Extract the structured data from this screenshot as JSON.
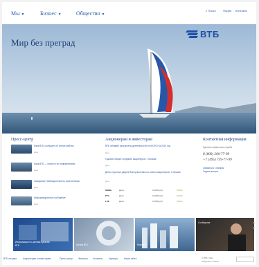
{
  "nav": {
    "menu": [
      {
        "label": "Мы"
      },
      {
        "label": "Бизнес"
      },
      {
        "label": "Общество"
      }
    ],
    "util": [
      "Поиск",
      "Форум",
      "Контакты"
    ]
  },
  "hero": {
    "title": "Мир без преград",
    "logo": "ВТБ"
  },
  "press": {
    "title": "Пресс-центр",
    "items": [
      {
        "text": "Банк ВТБ сообщает об итогах работы",
        "date": "Дата"
      },
      {
        "text": "Банк ВТБ — новости по направлениям",
        "date": "Дата"
      },
      {
        "text": "Заседание Наблюдательного совета банка",
        "date": "Дата"
      },
      {
        "text": "Информационное сообщение",
        "date": "Дата"
      }
    ]
  },
  "investors": {
    "title": "Акционерам и инвесторам",
    "items": [
      {
        "text": "ВТБ объявил результаты деятельности по МСФО за 2010 год",
        "date": "Дата"
      },
      {
        "text": "Годовое общее собрание акционеров, г. Москва",
        "date": "Дата"
      },
      {
        "text": "День открытых дверей Консультативного совета акционеров, г. Москва",
        "date": "Дата"
      }
    ],
    "quotes": [
      {
        "ticker": "ММВБ",
        "date": "Дата",
        "price": "0,0000 руб",
        "change": "0,00%"
      },
      {
        "ticker": "РТС",
        "date": "Дата",
        "price": "0,0000 руб",
        "change": "0,00%"
      },
      {
        "ticker": "LSE",
        "date": "Дата",
        "price": "0,0000 руб",
        "change": "0,00%"
      }
    ]
  },
  "contact": {
    "title": "Контактная информация",
    "subtitle": "Единая справочная служба",
    "phone1": "8 (800) 200-77-99",
    "phone2": "+7 (495) 739-77-99",
    "links": [
      "Связаться с банком",
      "Задать вопрос"
    ]
  },
  "banners": [
    {
      "caption": "Информация по ценным бумагам",
      "sub": "ВТБ"
    },
    {
      "caption": "Группа ВТБ",
      "sub": ""
    },
    {
      "caption": "Новости",
      "sub": ""
    },
    {
      "caption": "Сообщение",
      "sub": ""
    }
  ],
  "footer": {
    "links": [
      "ВТБ сегодня",
      "Акционерам и инвесторам",
      "Пресс-центр",
      "Финансы",
      "Контакты",
      "Карьера",
      "Карта сайта"
    ],
    "copyright": "© ВТБ, 2011",
    "note": "Сведения о банке"
  }
}
